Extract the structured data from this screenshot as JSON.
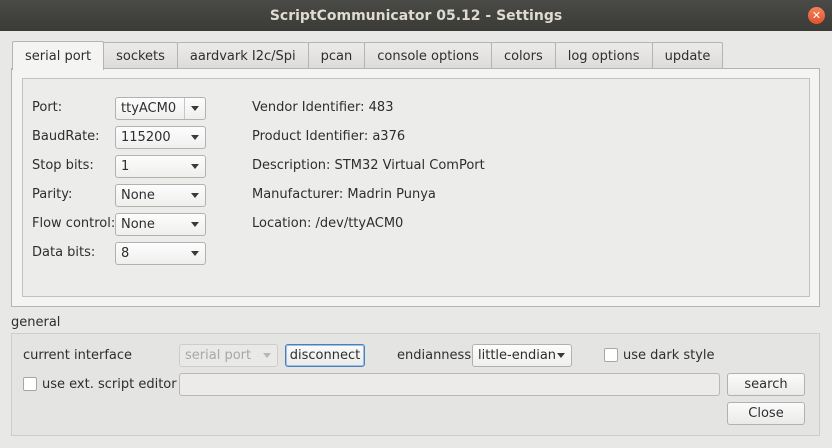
{
  "window": {
    "title": "ScriptCommunicator 05.12 - Settings"
  },
  "icons": {
    "close": "close-icon",
    "dropdown": "chevron-down-icon"
  },
  "colors": {
    "titlebar": "#3c3b37",
    "close_button": "#e95420",
    "focus": "#4c7fb7"
  },
  "tabs": [
    {
      "label": "serial port",
      "active": true
    },
    {
      "label": "sockets",
      "active": false
    },
    {
      "label": "aardvark I2c/Spi",
      "active": false
    },
    {
      "label": "pcan",
      "active": false
    },
    {
      "label": "console options",
      "active": false
    },
    {
      "label": "colors",
      "active": false
    },
    {
      "label": "log options",
      "active": false
    },
    {
      "label": "update",
      "active": false
    }
  ],
  "serial": {
    "port": {
      "label": "Port:",
      "value": "ttyACM0"
    },
    "baudrate": {
      "label": "BaudRate:",
      "value": "115200"
    },
    "stop_bits": {
      "label": "Stop bits:",
      "value": "1"
    },
    "parity": {
      "label": "Parity:",
      "value": "None"
    },
    "flow_control": {
      "label": "Flow control:",
      "value": "None"
    },
    "data_bits": {
      "label": "Data bits:",
      "value": "8"
    }
  },
  "device_info": {
    "vendor": "Vendor Identifier: 483",
    "product": "Product Identifier: a376",
    "description": "Description: STM32 Virtual ComPort",
    "manufacturer": "Manufacturer: Madrin Punya",
    "location": "Location: /dev/ttyACM0"
  },
  "general": {
    "title": "general",
    "current_interface_label": "current interface",
    "current_interface_value": "serial port",
    "disconnect_label": "disconnect",
    "endianness_label": "endianness",
    "endianness_value": "little-endian",
    "dark_style_label": "use dark style",
    "dark_style_checked": false,
    "ext_editor_label": "use ext. script editor",
    "ext_editor_checked": false,
    "editor_path": "",
    "search_label": "search",
    "close_label": "Close"
  }
}
